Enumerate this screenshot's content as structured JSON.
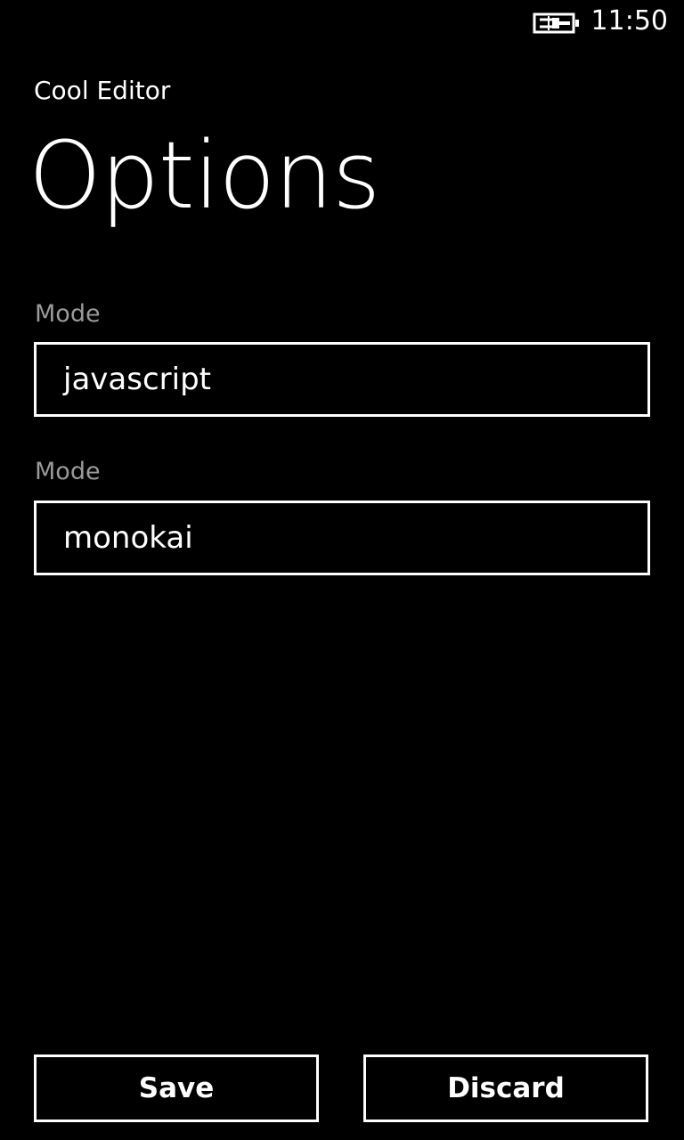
{
  "status_bar": {
    "clock": "11:50",
    "battery_icon": "battery-charging-icon"
  },
  "header": {
    "app_title": "Cool Editor",
    "page_title": "Options"
  },
  "fields": [
    {
      "label": "Mode",
      "value": "javascript"
    },
    {
      "label": "Mode",
      "value": "monokai"
    }
  ],
  "buttons": {
    "save_label": "Save",
    "discard_label": "Discard"
  },
  "colors": {
    "background": "#000000",
    "foreground": "#ffffff",
    "label": "#9a9a9a"
  }
}
